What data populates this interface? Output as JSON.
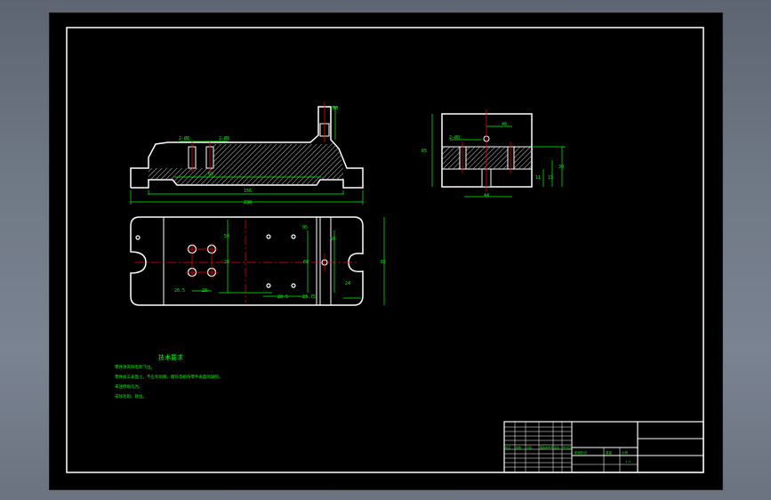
{
  "colors": {
    "background": "#000000",
    "outline": "#ffffff",
    "dimension": "#00ff00",
    "centerline": "#ff0000",
    "hatch": "#c8c8c8",
    "text_green": "#00ff00",
    "app_bg": "#6f7885"
  },
  "dimensions": {
    "front_view": {
      "top_left_small": "2-Ø8",
      "top_right_small": "2-Ø8",
      "inner_width": "60",
      "middle_width": "156",
      "overall_width": "230",
      "post_height": "50"
    },
    "plan_view": {
      "hole_span_v": "50",
      "hole_span_v2": "20",
      "hole_span_h1": "26.5",
      "hole_span_h2": "28",
      "right_v1": "95",
      "right_v2": "50",
      "right_v3": "60",
      "right_h1": "28.5",
      "right_h2": "23.75",
      "right_edge": "24",
      "overall_height": "85"
    },
    "side_view": {
      "top": "46",
      "small": "2-Ø8",
      "height_left": "65",
      "height_right1": "30",
      "height_right2": "11",
      "height_right3": "13",
      "bottom": "44"
    }
  },
  "notes": {
    "title": "技术要求",
    "lines": [
      "零件须去除毛刺飞边。",
      "零件加工表面上，不应有划痕、擦伤等损伤零件表面的缺陷。",
      "未注倒角均为。",
      "去除毛刺、锐边。"
    ]
  },
  "title_block": {
    "rows": [
      "标记",
      "处数",
      "分区",
      "更改文件号",
      "签名",
      "年月日"
    ],
    "fields": [
      "阶段标记",
      "重量",
      "比例"
    ],
    "scale": "1:1"
  }
}
